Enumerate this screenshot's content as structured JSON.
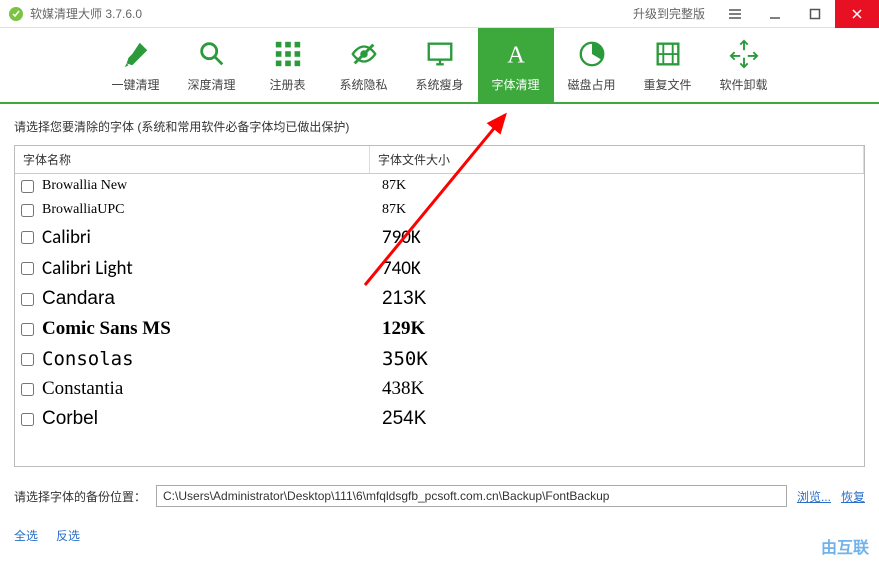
{
  "titlebar": {
    "title": "软媒清理大师 3.7.6.0",
    "upgrade": "升级到完整版"
  },
  "toolbar": {
    "items": [
      {
        "label": "一键清理",
        "icon": "brush"
      },
      {
        "label": "深度清理",
        "icon": "magnify"
      },
      {
        "label": "注册表",
        "icon": "grid"
      },
      {
        "label": "系统隐私",
        "icon": "eye-slash"
      },
      {
        "label": "系统瘦身",
        "icon": "monitor"
      },
      {
        "label": "字体清理",
        "icon": "font",
        "active": true
      },
      {
        "label": "磁盘占用",
        "icon": "pie"
      },
      {
        "label": "重复文件",
        "icon": "duplicate"
      },
      {
        "label": "软件卸载",
        "icon": "recycle"
      }
    ]
  },
  "prompt": "请选择您要清除的字体 (系统和常用软件必备字体均已做出保护)",
  "columns": {
    "name": "字体名称",
    "size": "字体文件大小"
  },
  "fonts": [
    {
      "name": "Browallia New",
      "size": "87K",
      "font": "serif",
      "big": false
    },
    {
      "name": "BrowalliaUPC",
      "size": "87K",
      "font": "serif",
      "big": false
    },
    {
      "name": "Calibri",
      "size": "790K",
      "font": "Calibri, sans-serif",
      "big": true
    },
    {
      "name": "Calibri Light",
      "size": "740K",
      "font": "'Calibri Light', Calibri, sans-serif",
      "big": true,
      "weight": "300"
    },
    {
      "name": "Candara",
      "size": "213K",
      "font": "Candara, sans-serif",
      "big": true
    },
    {
      "name": "Comic Sans MS",
      "size": "129K",
      "font": "'Comic Sans MS', cursive",
      "big": true,
      "bold": true
    },
    {
      "name": "Consolas",
      "size": "350K",
      "font": "Consolas, monospace",
      "big": true
    },
    {
      "name": "Constantia",
      "size": "438K",
      "font": "Constantia, serif",
      "big": true
    },
    {
      "name": "Corbel",
      "size": "254K",
      "font": "Corbel, sans-serif",
      "big": true
    }
  ],
  "backup": {
    "label": "请选择字体的备份位置：",
    "path": "C:\\Users\\Administrator\\Desktop\\111\\6\\mfqldsgfb_pcsoft.com.cn\\Backup\\FontBackup",
    "browse": "浏览...",
    "restore": "恢复"
  },
  "select": {
    "all": "全选",
    "invert": "反选"
  },
  "watermark": "由互联"
}
